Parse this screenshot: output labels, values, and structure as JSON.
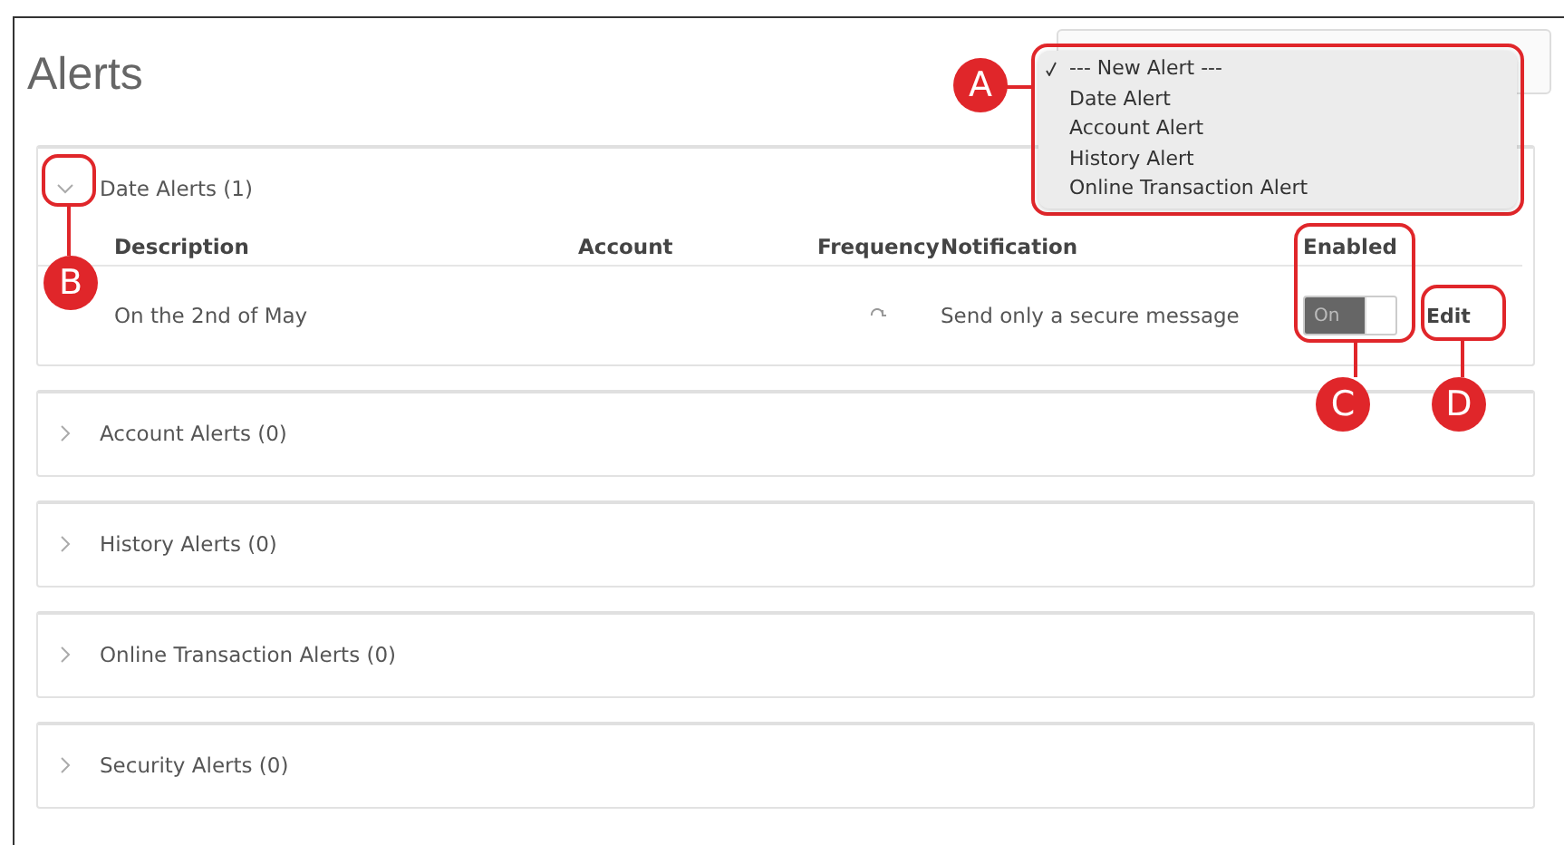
{
  "title": "Alerts",
  "new_alert_menu": {
    "items": [
      {
        "label": "--- New Alert ---",
        "selected": true
      },
      {
        "label": "Date Alert",
        "selected": false
      },
      {
        "label": "Account Alert",
        "selected": false
      },
      {
        "label": "History Alert",
        "selected": false
      },
      {
        "label": "Online Transaction Alert",
        "selected": false
      }
    ]
  },
  "sections": [
    {
      "title": "Date Alerts (1)",
      "expanded": true,
      "table": {
        "columns": [
          "Description",
          "Account",
          "Frequency",
          "Notification",
          "Enabled"
        ],
        "rows": [
          {
            "description": "On the 2nd of May",
            "notification": "Send only a secure message",
            "enabled": true,
            "toggle_label": "On",
            "action": "Edit"
          }
        ]
      }
    },
    {
      "title": "Account Alerts (0)",
      "expanded": false
    },
    {
      "title": "History Alerts (0)",
      "expanded": false
    },
    {
      "title": "Online Transaction Alerts (0)",
      "expanded": false
    },
    {
      "title": "Security Alerts (0)",
      "expanded": false
    }
  ],
  "callouts": [
    {
      "label": "A"
    },
    {
      "label": "B"
    },
    {
      "label": "C"
    },
    {
      "label": "D"
    }
  ]
}
